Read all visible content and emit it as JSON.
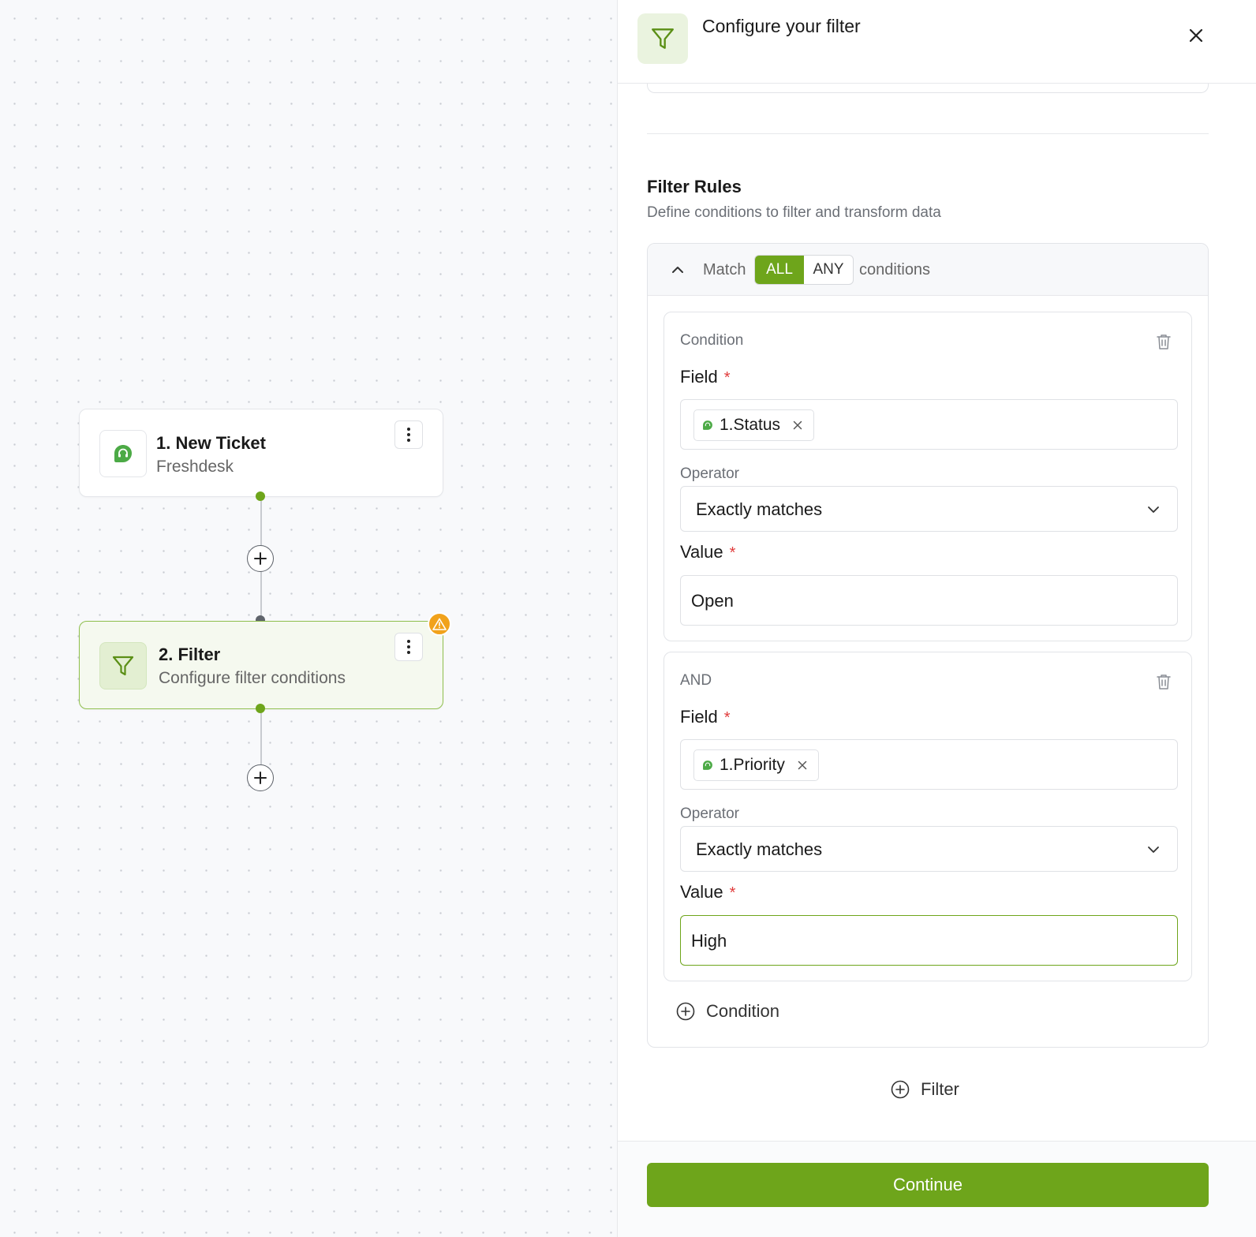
{
  "canvas": {
    "trigger_node": {
      "title": "1. New Ticket",
      "subtitle": "Freshdesk",
      "icon": "freshdesk-headset-icon"
    },
    "filter_node": {
      "title": "2. Filter",
      "subtitle": "Configure filter conditions",
      "icon": "filter-funnel-icon",
      "status": "warning"
    }
  },
  "panel": {
    "title": "Configure your filter",
    "section_title": "Filter Rules",
    "section_desc": "Define conditions to filter and transform data",
    "match": {
      "prefix": "Match",
      "options": [
        "ALL",
        "ANY"
      ],
      "selected": "ALL",
      "suffix": "conditions"
    },
    "conditions": [
      {
        "label": "Condition",
        "field_label": "Field",
        "required_mark": "*",
        "field_chip": "1.Status",
        "operator_label": "Operator",
        "operator_value": "Exactly matches",
        "value_label": "Value",
        "value": "Open"
      },
      {
        "label": "AND",
        "field_label": "Field",
        "required_mark": "*",
        "field_chip": "1.Priority",
        "operator_label": "Operator",
        "operator_value": "Exactly matches",
        "value_label": "Value",
        "value": "High"
      }
    ],
    "add_condition_label": "Condition",
    "add_filter_label": "Filter",
    "continue_label": "Continue"
  },
  "colors": {
    "accent": "#6ea51b",
    "warning": "#f1a21b",
    "required": "#e03b3b"
  }
}
